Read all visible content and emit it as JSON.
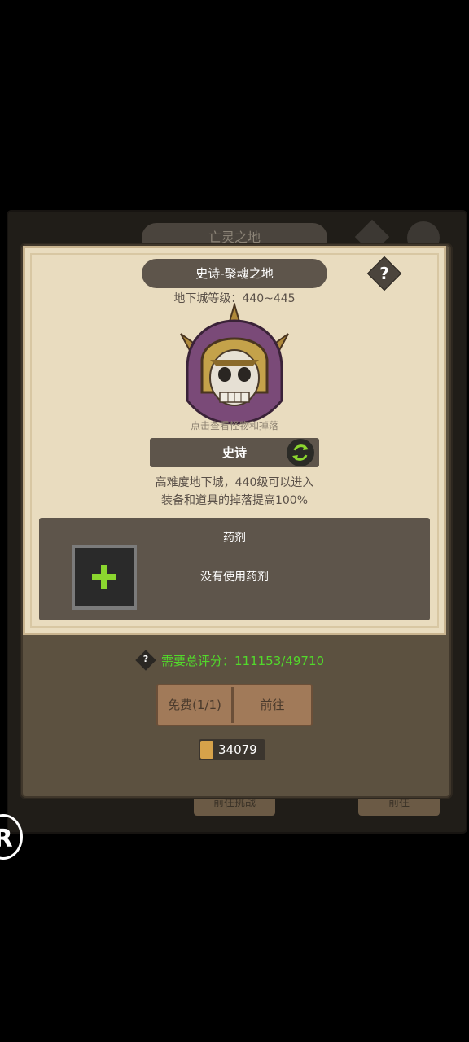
{
  "background": {
    "title": "亡灵之地",
    "left_button": "前往挑战",
    "right_button": "前往"
  },
  "dialog": {
    "title": "史诗-聚魂之地",
    "help_label": "?",
    "level_text": "地下城等级：440~445",
    "hint_text": "点击查看怪物和掉落",
    "difficulty_label": "史诗",
    "desc_line1": "高难度地下城，440级可以进入",
    "desc_line2": "装备和道具的掉落提高100%",
    "potion_title": "药剂",
    "potion_status": "没有使用药剂",
    "score_q": "?",
    "score_text": "需要总评分：111153/49710",
    "free_button": "免费(1/1)",
    "go_button": "前往",
    "currency_value": "34079"
  },
  "overlay": {
    "logo_text": "R"
  },
  "colors": {
    "score_green": "#52d92b",
    "plus_green": "#8bd62f",
    "parchment": "#e9dcbf",
    "dialog_brown": "#5c5140"
  }
}
